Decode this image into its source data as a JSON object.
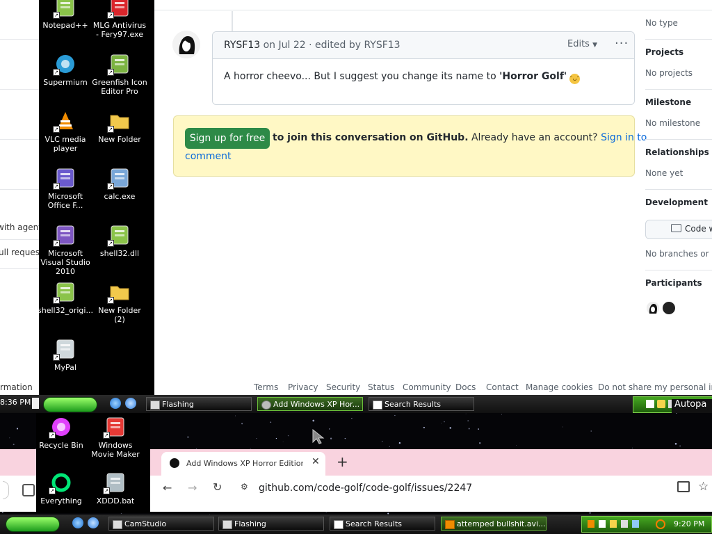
{
  "github": {
    "left_strip": {
      "text1": "with agent m",
      "text2": "ull requests",
      "text3": "rmation"
    },
    "comment": {
      "author": "RYSF13",
      "meta": " on Jul 22 · edited by ",
      "editor": "RYSF13",
      "edits_label": "Edits",
      "more_label": "···",
      "body_prefix": "A horror cheevo... But I suggest you change its name to ",
      "body_bold": "'Horror Golf'",
      "emoji": "😆"
    },
    "signup": {
      "button": "Sign up for free",
      "bold_text": "to join this conversation on GitHub.",
      "text": " Already have an account? ",
      "link1": "Sign in to",
      "link2": "comment"
    },
    "sidebar": {
      "type_value": "No type",
      "projects_label": "Projects",
      "projects_value": "No projects",
      "milestone_label": "Milestone",
      "milestone_value": "No milestone",
      "relationships_label": "Relationships",
      "relationships_value": "None yet",
      "development_label": "Development",
      "code_button": "Code w",
      "branches_value": "No branches or pu",
      "participants_label": "Participants"
    },
    "footer": [
      "Terms",
      "Privacy",
      "Security",
      "Status",
      "Community",
      "Docs",
      "Contact",
      "Manage cookies",
      "Do not share my personal infor"
    ]
  },
  "desktop_icons": [
    {
      "label": "Notepad++",
      "icon": "notepad-plus-icon",
      "color": "#8ac34a"
    },
    {
      "label": "MLG Antivirus - Fery97.exe",
      "icon": "mlg-antivirus-icon",
      "color": "#d9262c"
    },
    {
      "label": "Supermium",
      "icon": "supermium-icon",
      "color": "#2a9bd6"
    },
    {
      "label": "Greenfish Icon Editor Pro",
      "icon": "greenfish-icon",
      "color": "#7cb342"
    },
    {
      "label": "VLC media player",
      "icon": "vlc-icon",
      "color": "#f08c00"
    },
    {
      "label": "New Folder",
      "icon": "folder-icon",
      "color": "#f2c94c"
    },
    {
      "label": "Microsoft Office F...",
      "icon": "office-icon",
      "color": "#6a5acd"
    },
    {
      "label": "calc.exe",
      "icon": "calculator-icon",
      "color": "#7aa7d8"
    },
    {
      "label": "Microsoft Visual Studio 2010",
      "icon": "visual-studio-icon",
      "color": "#7e57c2"
    },
    {
      "label": "shell32.dll",
      "icon": "dll-icon",
      "color": "#8bc34a"
    },
    {
      "label": "shell32_origi...",
      "icon": "dll-icon",
      "color": "#8bc34a"
    },
    {
      "label": "New Folder (2)",
      "icon": "folder-icon",
      "color": "#f2c94c"
    },
    {
      "label": "MyPal",
      "icon": "mypal-icon",
      "color": "#cfd8dc"
    }
  ],
  "taskbar_top": {
    "clock": "8:36 PM",
    "buttons": [
      "Flashing",
      "Add Windows XP Hor...",
      "Search Results"
    ],
    "tray_text": "Autopa"
  },
  "desktop_icons2": [
    {
      "label": "Recycle Bin",
      "icon": "recycle-bin-icon",
      "color": "#e040fb"
    },
    {
      "label": "Windows Movie Maker",
      "icon": "movie-maker-icon",
      "color": "#e53935"
    },
    {
      "label": "Everything",
      "icon": "everything-icon",
      "color": "#00e676"
    },
    {
      "label": "XDDD.bat",
      "icon": "bat-icon",
      "color": "#b0bec5"
    }
  ],
  "chrome": {
    "tab_title": "Add Windows XP Horror Edition ch",
    "url": "github.com/code-golf/code-golf/issues/2247"
  },
  "taskbar_bottom": {
    "buttons": [
      "CamStudio",
      "Flashing",
      "Search Results",
      "attemped bullshit.avi..."
    ],
    "clock": "9:20 PM"
  }
}
